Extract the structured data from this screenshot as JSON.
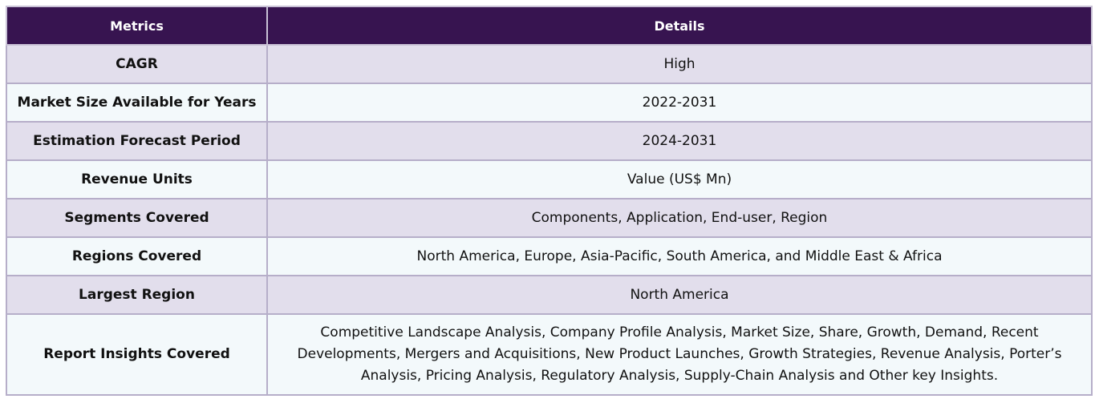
{
  "table": {
    "headers": [
      "Metrics",
      "Details"
    ],
    "rows": [
      {
        "metric": "CAGR",
        "details": "High"
      },
      {
        "metric": "Market Size Available for Years",
        "details": "2022-2031"
      },
      {
        "metric": "Estimation Forecast Period",
        "details": "2024-2031"
      },
      {
        "metric": "Revenue Units",
        "details": "Value (US$ Mn)"
      },
      {
        "metric": "Segments Covered",
        "details": "Components, Application, End-user, Region"
      },
      {
        "metric": "Regions Covered",
        "details": "North America, Europe, Asia-Pacific, South America, and Middle East & Africa"
      },
      {
        "metric": "Largest Region",
        "details": "North America"
      },
      {
        "metric": "Report Insights Covered",
        "details": "Competitive Landscape Analysis, Company Profile Analysis, Market Size, Share, Growth, Demand, Recent Developments, Mergers and Acquisitions, New Product Launches, Growth Strategies, Revenue Analysis, Porter’s Analysis, Pricing Analysis, Regulatory Analysis, Supply-Chain Analysis and Other key Insights."
      }
    ]
  },
  "colors": {
    "header_bg": "#371450",
    "header_text": "#ffffff",
    "row_odd_bg": "#e2deec",
    "row_even_bg": "#f3f9fb",
    "border": "#b6aec9"
  }
}
